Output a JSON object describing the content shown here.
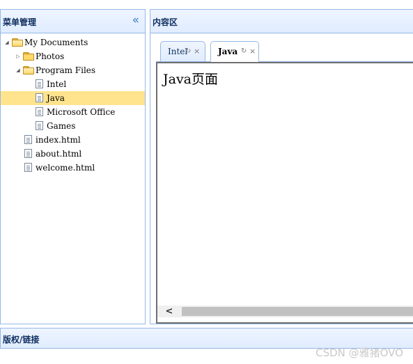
{
  "west": {
    "title": "菜单管理",
    "collapse_glyph": "«",
    "tree": [
      {
        "label": "My Documents",
        "type": "folder",
        "state": "open",
        "level": 0
      },
      {
        "label": "Photos",
        "type": "folder",
        "state": "closed",
        "level": 1
      },
      {
        "label": "Program Files",
        "type": "folder",
        "state": "open",
        "level": 1
      },
      {
        "label": "Intel",
        "type": "file",
        "level": 2
      },
      {
        "label": "Java",
        "type": "file",
        "level": 2,
        "selected": true
      },
      {
        "label": "Microsoft Office",
        "type": "file",
        "level": 2
      },
      {
        "label": "Games",
        "type": "file",
        "level": 2
      },
      {
        "label": "index.html",
        "type": "file",
        "level": 1
      },
      {
        "label": "about.html",
        "type": "file",
        "level": 1
      },
      {
        "label": "welcome.html",
        "type": "file",
        "level": 1
      }
    ]
  },
  "center": {
    "title": "内容区",
    "tabs": [
      {
        "title": "Intel",
        "refresh_glyph": "↻",
        "close_glyph": "×",
        "active": false
      },
      {
        "title": "Java",
        "refresh_glyph": "↻",
        "close_glyph": "×",
        "active": true
      }
    ],
    "content_heading": "Java页面",
    "scroll_left_glyph": "<"
  },
  "south": {
    "title": "版权/链接"
  },
  "watermark": "CSDN @雅猪OVO",
  "colors": {
    "border": "#95b8e7",
    "header_bg": "#e0ecff",
    "selected_bg": "#ffe48d",
    "collapse_accent": "#3d7ec9"
  }
}
